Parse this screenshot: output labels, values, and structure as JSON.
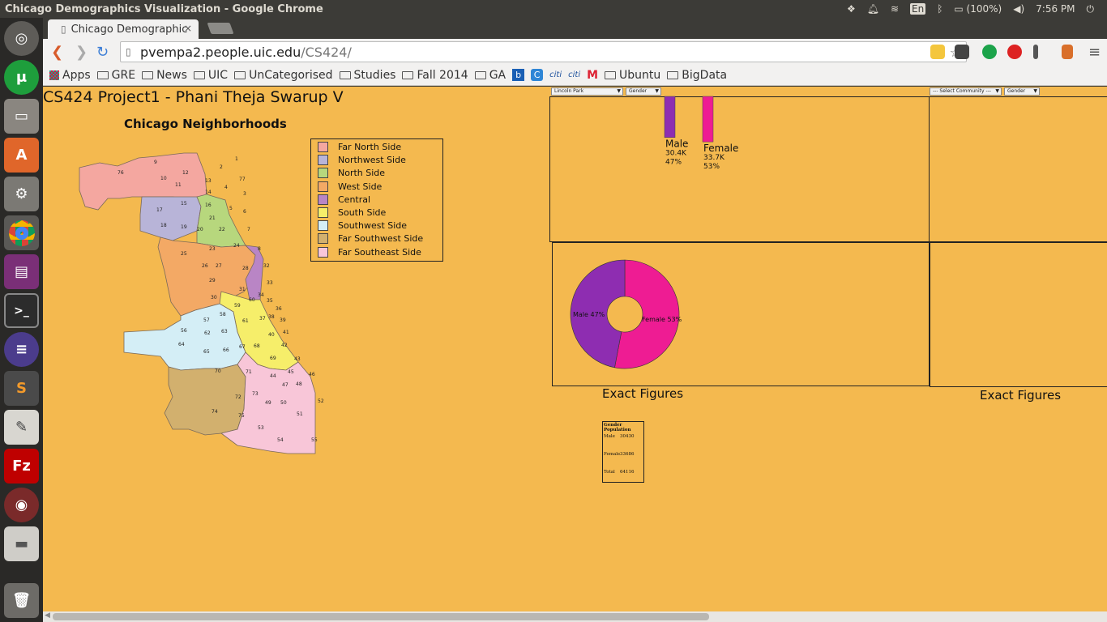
{
  "window": {
    "title": "Chicago Demographics Visualization - Google Chrome",
    "tray": {
      "lang": "En",
      "battery": "(100%)",
      "time": "7:56 PM"
    }
  },
  "tab": {
    "title": "Chicago Demographic",
    "close": "×"
  },
  "url": {
    "host": "pvempa2.people.uic.edu",
    "path": "/CS424/"
  },
  "bookmarks": [
    "Apps",
    "GRE",
    "News",
    "UIC",
    "UnCategorised",
    "Studies",
    "Fall 2014",
    "GA",
    "Ubuntu",
    "BigData"
  ],
  "page": {
    "title": "CS424 Project1 - Phani Theja Swarup V",
    "map_title": "Chicago Neighborhoods",
    "legend": [
      {
        "label": "Far North Side",
        "color": "#f4a7a0"
      },
      {
        "label": "Northwest Side",
        "color": "#b8b4d8"
      },
      {
        "label": "North Side",
        "color": "#b7d77d"
      },
      {
        "label": "West Side",
        "color": "#f3a965"
      },
      {
        "label": "Central",
        "color": "#b985c5"
      },
      {
        "label": "South Side",
        "color": "#f6ee6a"
      },
      {
        "label": "Southwest Side",
        "color": "#d4eef6"
      },
      {
        "label": "Far Southwest Side",
        "color": "#d2b06e"
      },
      {
        "label": "Far Southeast Side",
        "color": "#f8c6d8"
      }
    ],
    "selectors": {
      "community_left": "Lincoln Park",
      "category_left": "Gender",
      "community_right": "--- Select Community ---",
      "category_right": "Gender"
    },
    "exact_figures_left": "Exact Figures",
    "exact_figures_right": "Exact Figures",
    "table": {
      "header": "Gender Population",
      "rows": [
        {
          "label": "Male",
          "value": "30430"
        },
        {
          "label": "Female",
          "value": "33686"
        },
        {
          "label": "Total",
          "value": "64116"
        }
      ]
    }
  },
  "chart_data": [
    {
      "type": "bar",
      "categories": [
        "Male",
        "Female"
      ],
      "values": [
        30430,
        33686
      ],
      "value_labels": [
        "30.4K",
        "33.7K"
      ],
      "percent_labels": [
        "47%",
        "53%"
      ],
      "colors": [
        "#8e2db1",
        "#ee1c93"
      ]
    },
    {
      "type": "pie",
      "labels": [
        "Male 47%",
        "Female 53%"
      ],
      "values": [
        47,
        53
      ],
      "colors": [
        "#8e2db1",
        "#ee1c93"
      ],
      "donut": true
    }
  ]
}
